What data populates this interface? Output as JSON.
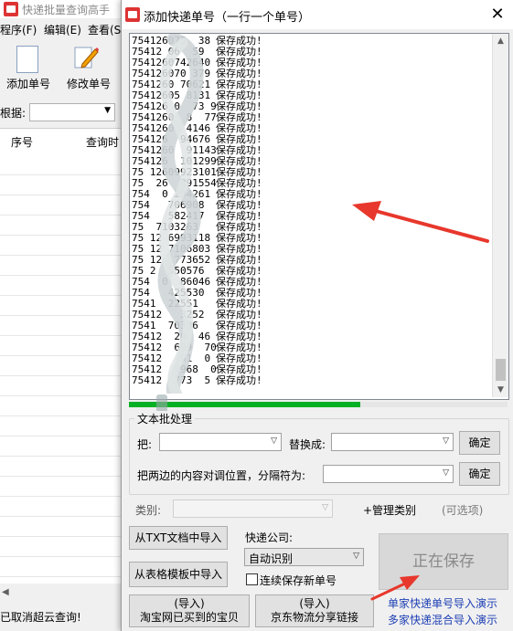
{
  "main_window": {
    "title": "快递批量查询高手",
    "menu": [
      "程序(F)",
      "编辑(E)",
      "查看(S"
    ],
    "toolbar": {
      "add_label": "添加单号",
      "edit_label": "修改单号"
    },
    "filter_label": "根据:",
    "grid_headers": [
      "序号",
      "查询时"
    ],
    "status_text": "已取消超云查询!"
  },
  "dialog": {
    "title": "添加快递单号（一行一个单号）",
    "close_glyph": "✕",
    "log_lines": [
      {
        "num": "754126075  38",
        "msg": "保存成功!"
      },
      {
        "num": "75412 06  59",
        "msg": "保存成功!"
      },
      {
        "num": "7541260742640",
        "msg": "保存成功!"
      },
      {
        "num": "754126070 379",
        "msg": "保存成功!"
      },
      {
        "num": "7541260 70621",
        "msg": "保存成功!"
      },
      {
        "num": "75412605 8131",
        "msg": "保存成功!"
      },
      {
        "num": "754126 0  73 9",
        "msg": "保存成功!"
      },
      {
        "num": "7541260  8  77",
        "msg": "保存成功!"
      },
      {
        "num": "7541260  4146",
        "msg": "保存成功!"
      },
      {
        "num": "754126  94676",
        "msg": "保存成功!"
      },
      {
        "num": "7541260  91143",
        "msg": "保存成功!"
      },
      {
        "num": "754126  101299",
        "msg": "保存成功!"
      },
      {
        "num": "75 12609923101",
        "msg": "保存成功!"
      },
      {
        "num": "75  26  891554",
        "msg": "保存成功!"
      },
      {
        "num": "754  0 294261",
        "msg": "保存成功!"
      },
      {
        "num": "754   706908",
        "msg": "保存成功!"
      },
      {
        "num": "754   582417",
        "msg": "保存成功!"
      },
      {
        "num": "75  7103263",
        "msg": "保存成功!"
      },
      {
        "num": "75 12 6993118",
        "msg": "保存成功!"
      },
      {
        "num": "75 12 7106803",
        "msg": "保存成功!"
      },
      {
        "num": "75 12  773652",
        "msg": "保存成功!"
      },
      {
        "num": "75 2  550576",
        "msg": "保存成功!"
      },
      {
        "num": "754  0  86046",
        "msg": "保存成功!"
      },
      {
        "num": "754   425530",
        "msg": "保存成功!"
      },
      {
        "num": "7541  22551",
        "msg": "保存成功!"
      },
      {
        "num": "75412   3252",
        "msg": "保存成功!"
      },
      {
        "num": "7541  70396",
        "msg": "保存成功!"
      },
      {
        "num": "75412  20  46",
        "msg": "保存成功!"
      },
      {
        "num": "75412  699  70",
        "msg": "保存成功!"
      },
      {
        "num": "75412   91  0",
        "msg": "保存成功!"
      },
      {
        "num": "75412  7968  0",
        "msg": "保存成功!"
      },
      {
        "num": "75412  773  5",
        "msg": "保存成功!"
      }
    ],
    "progress_fraction": 0.61,
    "text_processing": {
      "group_title": "文本批处理",
      "replace_from_label": "把:",
      "replace_to_label": "替换成:",
      "confirm_label": "确定",
      "swap_label": "把两边的内容对调位置，分隔符为:",
      "swap_confirm_label": "确定"
    },
    "category": {
      "label": "类别:",
      "manage_label": "+管理类别",
      "optional_label": "(可选项)"
    },
    "import_txt_label": "从TXT文档中导入",
    "import_table_label": "从表格模板中导入",
    "courier": {
      "label": "快递公司:",
      "selected": "自动识别",
      "continuous_label": "连续保存新单号",
      "continuous_checked": false
    },
    "save_button_label": "正在保存",
    "taobao_import": {
      "line1": "(导入)",
      "line2": "淘宝网已买到的宝贝"
    },
    "jd_import": {
      "line1": "(导入)",
      "line2": "京东物流分享链接"
    },
    "demo_links": [
      "单家快递单号导入演示",
      "多家快递混合导入演示"
    ],
    "colors": {
      "progress": "#06b025",
      "link": "#1d3fb4",
      "arrow": "#e8372c"
    }
  }
}
